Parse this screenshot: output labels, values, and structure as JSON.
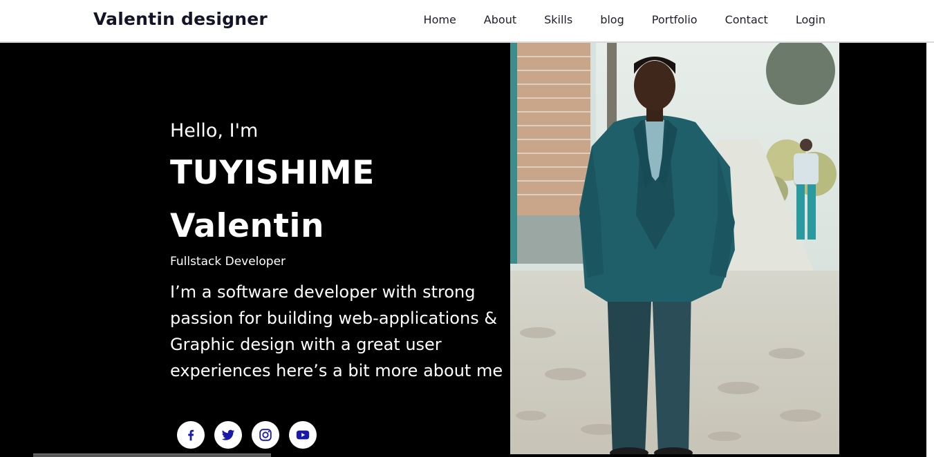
{
  "header": {
    "brand": "Valentin designer",
    "nav": [
      "Home",
      "About",
      "Skills",
      "blog",
      "Portfolio",
      "Contact",
      "Login"
    ]
  },
  "hero": {
    "greeting": "Hello, I'm",
    "name_line1": "TUYISHIME",
    "name_line2": "Valentin",
    "role": "Fullstack Developer",
    "bio": "I’m a software developer with strong passion for building web-applications & Graphic design with a great user experiences here’s a bit more about me"
  },
  "socials": [
    {
      "icon": "facebook-icon"
    },
    {
      "icon": "twitter-icon"
    },
    {
      "icon": "instagram-icon"
    },
    {
      "icon": "youtube-icon"
    }
  ],
  "colors": {
    "background": "#000000",
    "header_bg": "#ffffff",
    "brand_text": "#141428",
    "social_icon": "#1a1aa8"
  }
}
